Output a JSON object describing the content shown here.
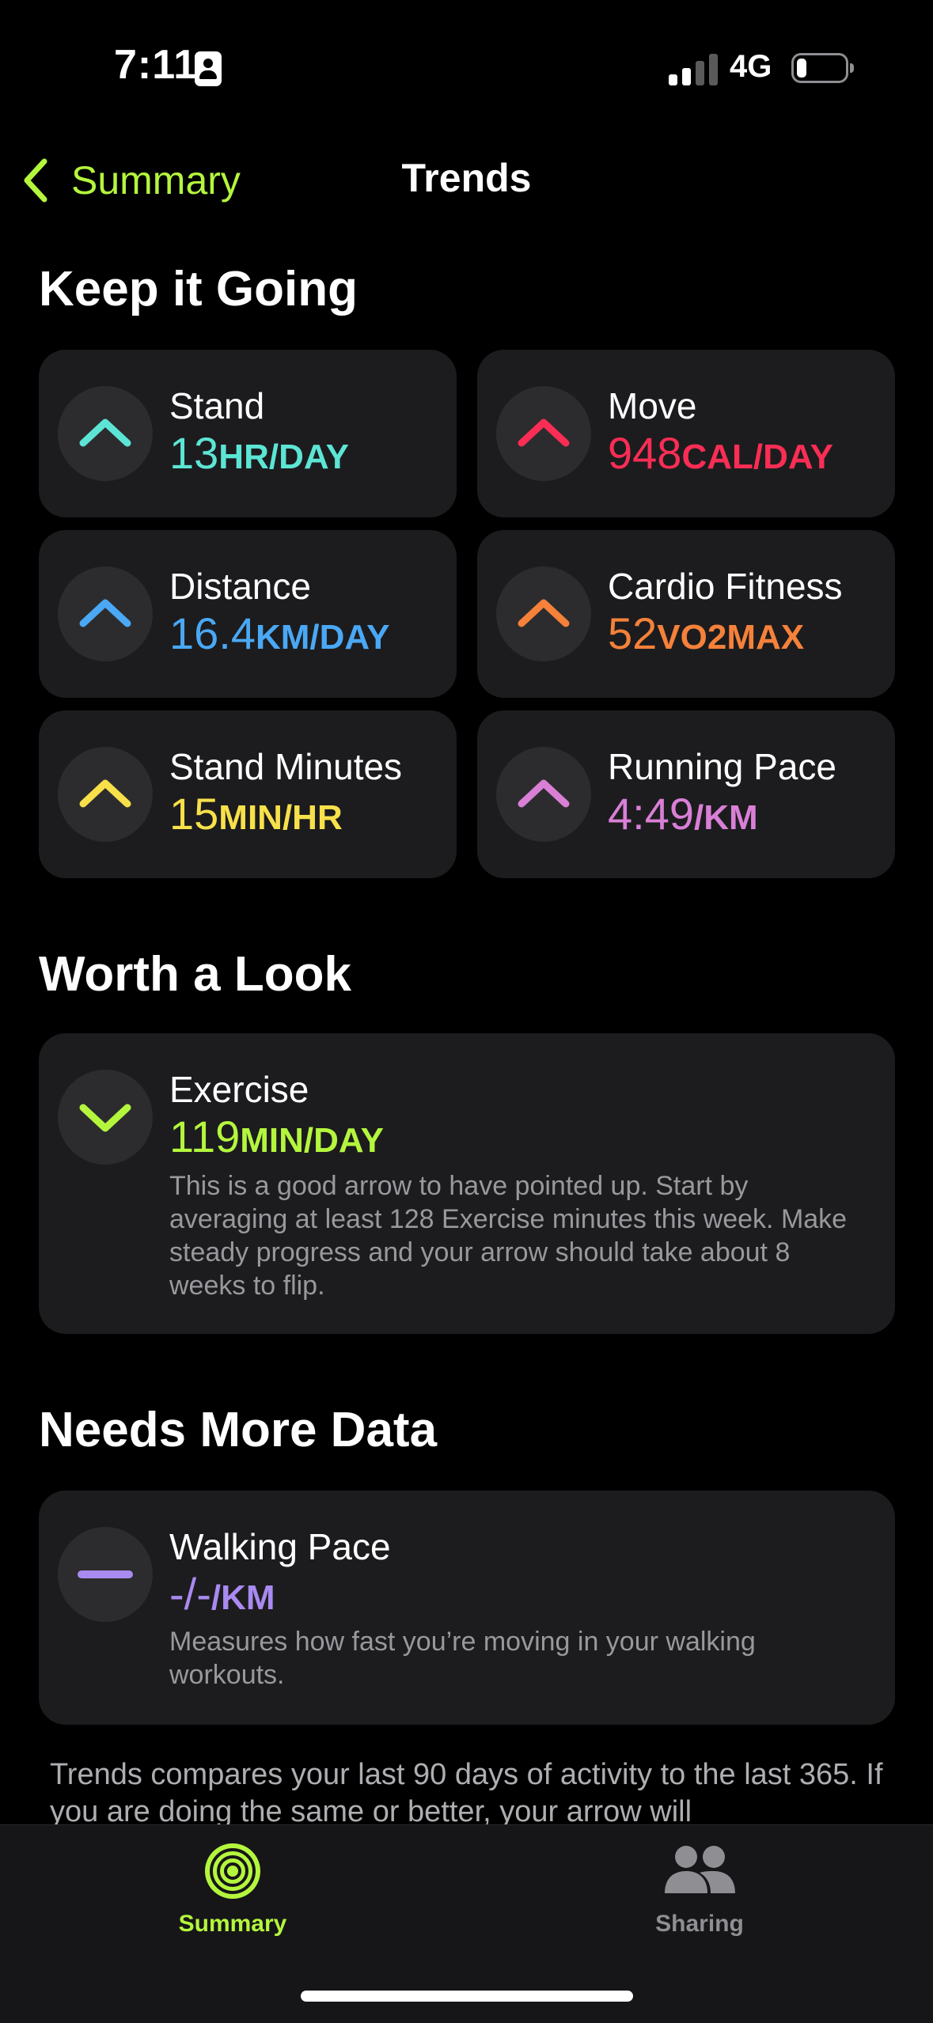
{
  "status_bar": {
    "time": "7:11",
    "network": "4G"
  },
  "nav": {
    "back_label": "Summary",
    "title": "Trends"
  },
  "sections": {
    "keep_going": "Keep it Going",
    "worth_look": "Worth a Look",
    "needs_data": "Needs More Data"
  },
  "keep_going_cards": [
    {
      "label": "Stand",
      "value": "13",
      "unit": "HR/DAY",
      "color": "#5ce5d5",
      "arrow": "up"
    },
    {
      "label": "Move",
      "value": "948",
      "unit": "CAL/DAY",
      "color": "#fa2d55",
      "arrow": "up"
    },
    {
      "label": "Distance",
      "value": "16.4",
      "unit": "KM/DAY",
      "color": "#4aa8f5",
      "arrow": "up"
    },
    {
      "label": "Cardio Fitness",
      "value": "52",
      "unit": "VO2MAX",
      "color": "#f5813a",
      "arrow": "up"
    },
    {
      "label": "Stand Minutes",
      "value": "15",
      "unit": "MIN/HR",
      "color": "#f7e04a",
      "arrow": "up"
    },
    {
      "label": "Running Pace",
      "value": "4:49",
      "unit": "/KM",
      "color": "#d97fd6",
      "arrow": "up"
    }
  ],
  "worth_look_card": {
    "label": "Exercise",
    "value": "119",
    "unit": "MIN/DAY",
    "color": "#b4f63d",
    "arrow": "down",
    "description": "This is a good arrow to have pointed up. Start by averaging at least 128 Exercise minutes this week. Make steady progress and your arrow should take about 8 weeks to flip."
  },
  "needs_data_card": {
    "label": "Walking Pace",
    "value": "-/-",
    "unit": "/KM",
    "color": "#a98af0",
    "arrow": "dash",
    "description": "Measures how fast you’re moving in your walking workouts."
  },
  "footnote": "Trends compares your last 90 days of activity to the last 365. If you are doing the same or better, your arrow will",
  "tabs": [
    {
      "label": "Summary",
      "icon": "activity-rings-icon",
      "active": true
    },
    {
      "label": "Sharing",
      "icon": "people-icon",
      "active": false
    }
  ]
}
